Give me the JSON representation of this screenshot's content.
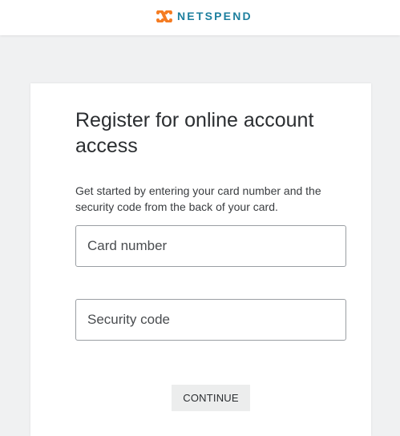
{
  "header": {
    "brand": "NETSPEND",
    "logo_icon": "netspend-logo-icon",
    "brand_color": "#1d7f9e",
    "logo_color": "#f57c22"
  },
  "main": {
    "title": "Register for online account access",
    "intro": "Get started by entering your card number and the security code from the back of your card.",
    "card_number": {
      "placeholder": "Card number",
      "value": ""
    },
    "security_code": {
      "placeholder": "Security code",
      "value": ""
    },
    "continue_label": "CONTINUE"
  }
}
